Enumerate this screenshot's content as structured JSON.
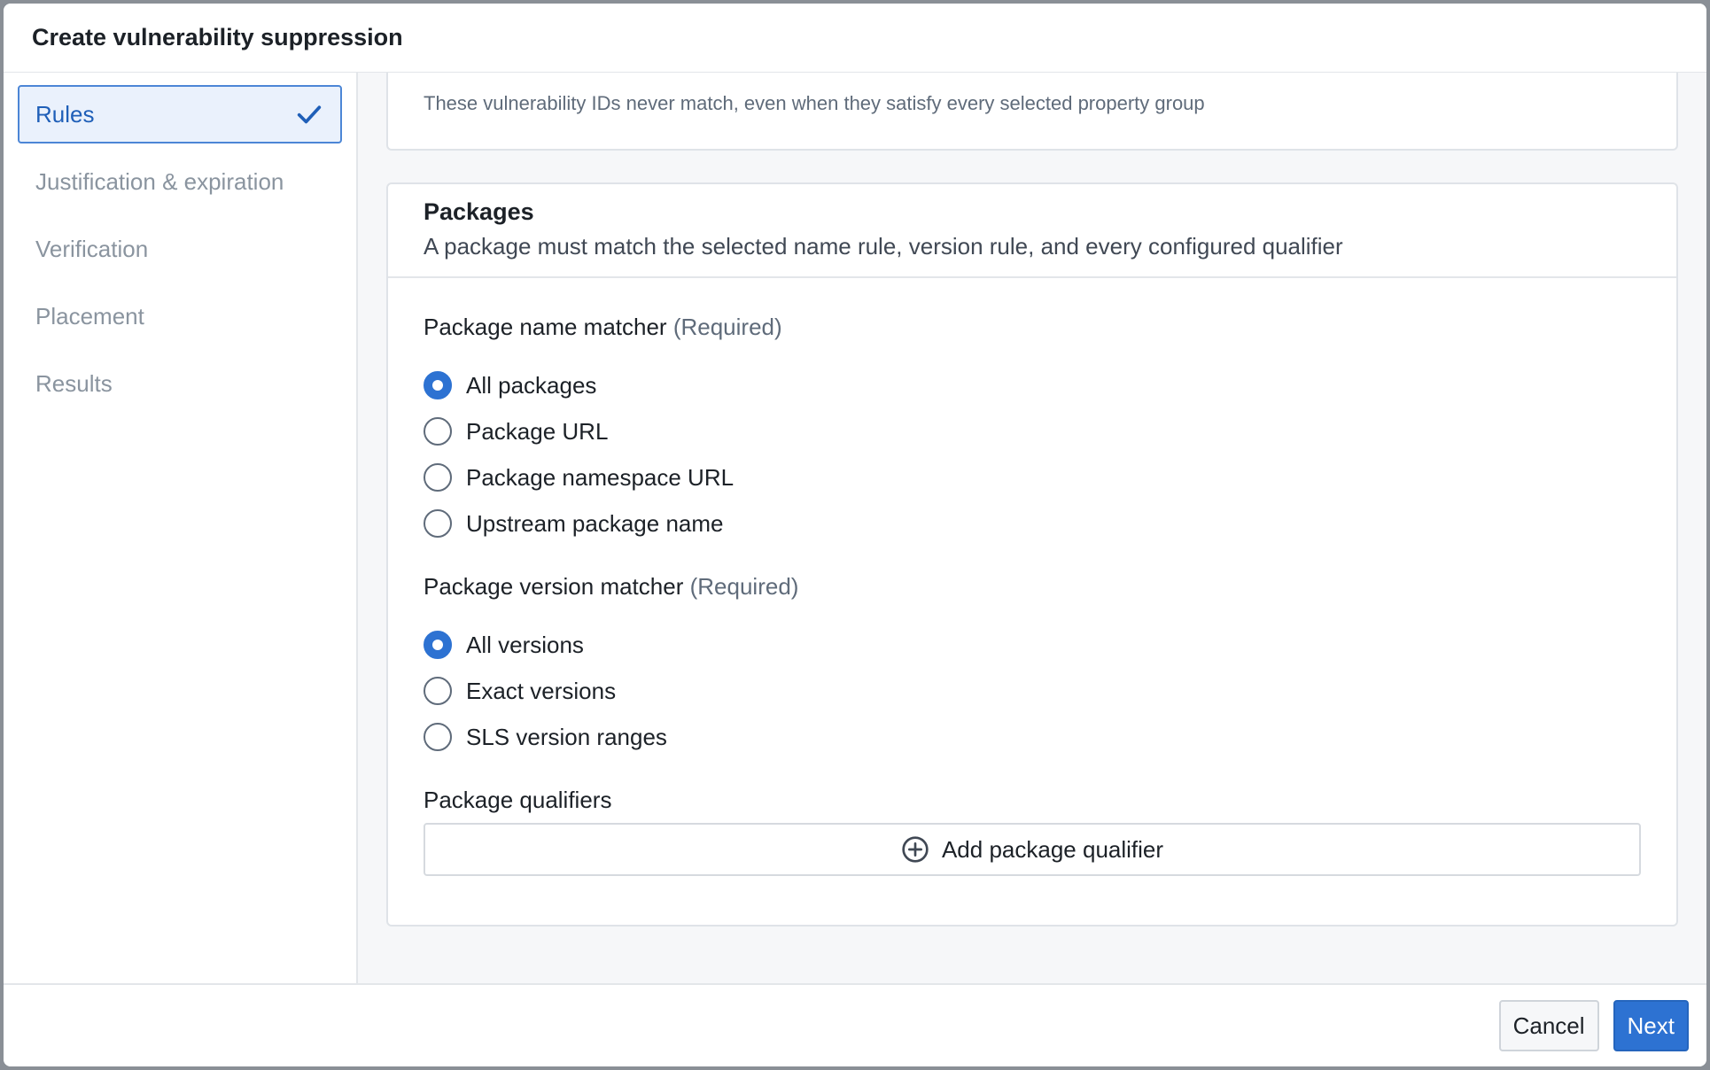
{
  "dialog": {
    "title": "Create vulnerability suppression"
  },
  "sidebar": {
    "steps": [
      {
        "label": "Rules",
        "state": "active-complete",
        "icon": "checkmark-icon"
      },
      {
        "label": "Justification & expiration"
      },
      {
        "label": "Verification"
      },
      {
        "label": "Placement"
      },
      {
        "label": "Results"
      }
    ]
  },
  "ids_card": {
    "hint": "These vulnerability IDs never match, even when they satisfy every selected property group"
  },
  "packages": {
    "title": "Packages",
    "subtitle": "A package must match the selected name rule, version rule, and every configured qualifier",
    "name_matcher": {
      "label": "Package name matcher",
      "required": "(Required)",
      "options": [
        "All packages",
        "Package URL",
        "Package namespace URL",
        "Upstream package name"
      ],
      "selected": "All packages"
    },
    "version_matcher": {
      "label": "Package version matcher",
      "required": "(Required)",
      "options": [
        "All versions",
        "Exact versions",
        "SLS version ranges"
      ],
      "selected": "All versions"
    },
    "qualifiers": {
      "label": "Package qualifiers",
      "add_label": "Add package qualifier",
      "icon": "add-circle-icon"
    }
  },
  "footer": {
    "cancel_label": "Cancel",
    "next_label": "Next"
  },
  "colors": {
    "primary": "#2d72d2",
    "active_bg": "#eaf1fc"
  }
}
